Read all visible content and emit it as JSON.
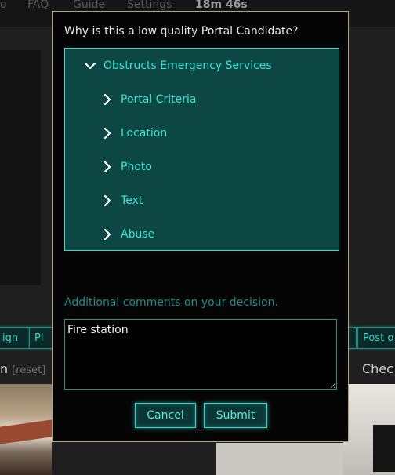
{
  "nav": {
    "items": [
      "o",
      "FAQ",
      "Guide",
      "Settings"
    ],
    "timer": "18m 46s"
  },
  "background": {
    "buttons": [
      "ign",
      "Pl",
      "",
      "Post o"
    ],
    "label_left": "n",
    "label_reset": "[reset]",
    "label_right": "Chec"
  },
  "modal": {
    "title": "Why is this a low quality Portal Candidate?",
    "reasons": [
      {
        "label": "Obstructs Emergency Services",
        "expanded": true
      },
      {
        "label": "Portal Criteria",
        "expanded": false
      },
      {
        "label": "Location",
        "expanded": false
      },
      {
        "label": "Photo",
        "expanded": false
      },
      {
        "label": "Text",
        "expanded": false
      },
      {
        "label": "Abuse",
        "expanded": false
      }
    ],
    "comments_label": "Additional comments on your decision.",
    "comments_value": "Fire station",
    "cancel_label": "Cancel",
    "submit_label": "Submit"
  },
  "colors": {
    "accent": "#3fe3d9",
    "tree_bg": "#0c4743",
    "modal_border": "#b7a27c"
  }
}
